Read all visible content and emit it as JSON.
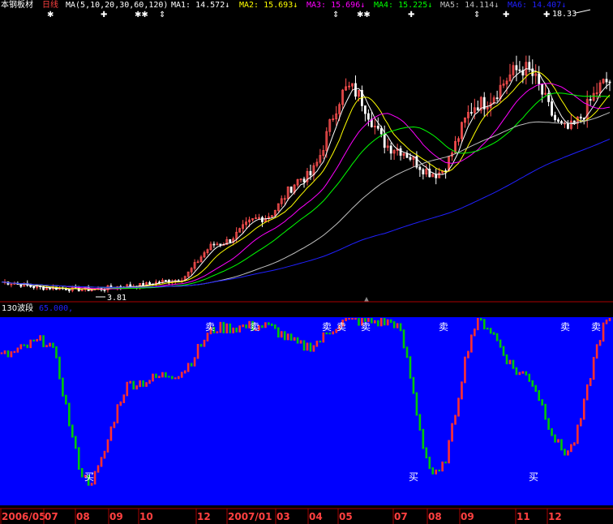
{
  "window": {
    "stock_name": "本钢板材",
    "period": "日线",
    "ma_spec": "MA(5,10,20,30,60,120)",
    "ma_readouts": [
      {
        "label": "MA1:",
        "value": "14.572",
        "arrow": "↓",
        "color": "#ffffff"
      },
      {
        "label": "MA2:",
        "value": "15.693",
        "arrow": "↓",
        "color": "#ffff00"
      },
      {
        "label": "MA3:",
        "value": "15.696",
        "arrow": "↓",
        "color": "#ff00ff"
      },
      {
        "label": "MA4:",
        "value": "15.225",
        "arrow": "↓",
        "color": "#00ff00"
      },
      {
        "label": "MA5:",
        "value": "14.114",
        "arrow": "↓",
        "color": "#c0c0c0"
      },
      {
        "label": "MA6:",
        "value": "14.407",
        "arrow": "↓",
        "color": "#2020ff"
      }
    ],
    "high_label": "18.33",
    "low_label": "3.81"
  },
  "indicator": {
    "name": "130波段",
    "value": "65.000,",
    "buy_label": "买",
    "sell_label": "卖"
  },
  "axis": {
    "date_labels": [
      "2006/05",
      "07",
      "08",
      "09",
      "10",
      "12",
      "2007/01",
      "03",
      "04",
      "05",
      "07",
      "08",
      "09",
      "11",
      "12"
    ]
  },
  "colors": {
    "background": "#000000",
    "indicator_bg": "#0000ff",
    "up": "#ff3030",
    "down": "#00c800",
    "axis_text": "#ff4040",
    "divider": "#aa0000",
    "label_white": "#ffffff"
  },
  "chart_data": [
    {
      "type": "line",
      "name": "price",
      "title": "",
      "x": [
        "2006/05",
        "07",
        "08",
        "09",
        "10",
        "12",
        "2007/01",
        "03",
        "04",
        "05",
        "07",
        "08",
        "09",
        "11",
        "12"
      ],
      "series": [
        {
          "name": "MA1",
          "values": [
            4.3,
            4.0,
            3.9,
            4.1,
            4.4,
            6.4,
            7.8,
            10.0,
            14.8,
            11.6,
            10.2,
            14.0,
            15.9,
            12.6,
            15.2
          ]
        },
        {
          "name": "MA6",
          "values": [
            4.2,
            4.0,
            3.9,
            3.9,
            4.0,
            4.3,
            4.8,
            5.7,
            7.4,
            9.3,
            10.9,
            12.7,
            13.6,
            14.1,
            14.4
          ]
        }
      ],
      "annotations": [
        {
          "text": "18.33",
          "x": "12",
          "y": 18.33,
          "kind": "high"
        },
        {
          "text": "3.81",
          "x": "07",
          "y": 3.81,
          "kind": "low"
        }
      ],
      "ylim": [
        3.5,
        19
      ]
    },
    {
      "type": "bar",
      "name": "130波段",
      "title": "",
      "categories": [
        "2006/05",
        "07",
        "08",
        "09",
        "10",
        "12",
        "2007/01",
        "03",
        "04",
        "05",
        "07",
        "08",
        "09",
        "11",
        "12"
      ],
      "values": [
        80,
        88,
        12,
        65,
        70,
        95,
        96,
        85,
        99,
        98,
        15,
        98,
        70,
        28,
        99
      ],
      "signals": [
        {
          "text": "买",
          "x": "08",
          "y": 8
        },
        {
          "text": "卖",
          "x": "12",
          "y": 97
        },
        {
          "text": "卖",
          "x": "2007/01",
          "y": 97
        },
        {
          "text": "卖",
          "x": "04",
          "y": 99
        },
        {
          "text": "卖",
          "x": "05",
          "y": 99
        },
        {
          "text": "买",
          "x": "07",
          "y": 10
        },
        {
          "text": "卖",
          "x": "08",
          "y": 99
        },
        {
          "text": "买",
          "x": "11",
          "y": 10
        },
        {
          "text": "卖",
          "x": "12",
          "y": 99
        }
      ],
      "ylim": [
        0,
        100
      ]
    }
  ]
}
